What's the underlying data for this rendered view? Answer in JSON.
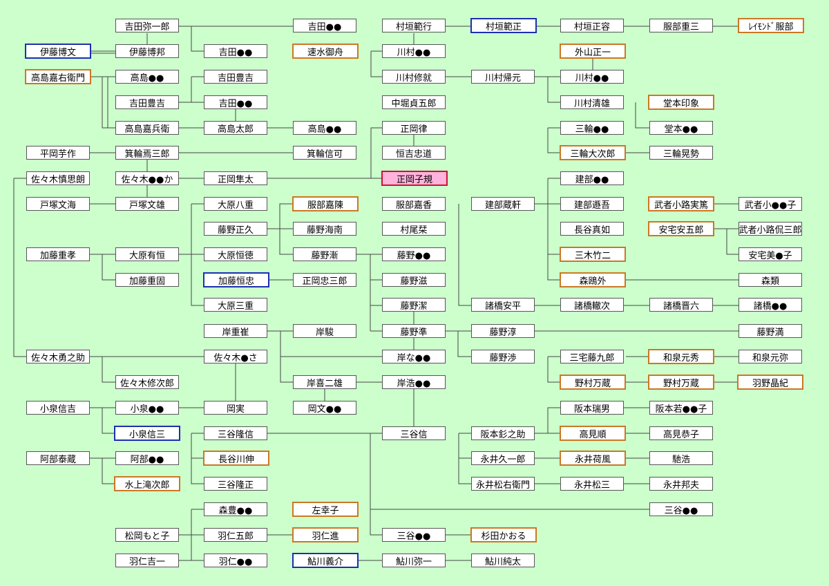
{
  "colors": {
    "background": "#ccffcc",
    "line": "#444444",
    "blue": "#1a2fb0",
    "orange": "#cc7722",
    "red": "#cc1133",
    "pink": "#ffb3dd"
  },
  "people": {
    "yoshida_yaichiro": "吉田弥一郎",
    "yoshida_a": "吉田●●",
    "murakaki_norimichi": "村垣範行",
    "murakaki_norimasa": "村垣範正",
    "murakaki_masakata": "村垣正容",
    "hattori_juzo": "服部重三",
    "raymond_hattori": "ﾚｲﾓﾝﾄﾞ服部",
    "ito_hirobumi": "伊藤博文",
    "ito_hirokuni": "伊藤博邦",
    "yoshida_b": "吉田●●",
    "hayami_gyoshu": "速水御舟",
    "kawamura_a": "川村●●",
    "toyama_masakazu": "外山正一",
    "takashima_kaemon": "高島嘉右衛門",
    "takashima_a": "高島●●",
    "yoshida_toyokichi2": "吉田豊吉",
    "kawamura_shuju": "川村修就",
    "kawamura_kigen": "川村帰元",
    "kawamura_b": "川村●●",
    "yoshida_toyokichi": "吉田豊吉",
    "yoshida_c": "吉田●●",
    "nakabori": "中堀貞五郎",
    "kawamura_kiyoo": "川村清雄",
    "domoto_insho": "堂本印象",
    "takashima_kahei": "高島嘉兵衛",
    "takashima_taro": "高島太郎",
    "takashima_b": "高島●●",
    "masaoka_ritsu": "正岡律",
    "miwa_a": "三輪●●",
    "domoto_a": "堂本●●",
    "hiraoka_imosaku": "平岡芋作",
    "minowa_eizaburo": "箕輪焉三郎",
    "minowa_nobuyoshi": "箕輪信可",
    "tsuneyoshi": "恒吉忠道",
    "miwa_daijiro": "三輪大次郎",
    "miwa_koshi": "三輪晃勢",
    "sasaki_shinshiro": "佐々木慎思朗",
    "sasaki_a": "佐々木●●か",
    "masaoka_hayata": "正岡隼太",
    "masaoka_shiki": "正岡子規",
    "takebe_a": "建部●●",
    "totsuka_bunkai": "戸塚文海",
    "totsuka_fumio": "戸塚文雄",
    "ohara_hachie": "大原八重",
    "hattori_kaetsu": "服部嘉陳",
    "hattori_kaka": "服部嘉香",
    "takebe_kuraki": "建部蔵軒",
    "takebe_tongo": "建部遯吾",
    "mushanokoji_saneatsu": "武者小路実篤",
    "mushanokoji_a": "武者小●●子",
    "fujino_masahisa": "藤野正久",
    "fujino_kainan": "藤野海南",
    "murao_ui": "村尾栞",
    "hasegawa_nyoze": "長谷真如",
    "yasugi_yasugoro": "安宅安五郎",
    "mushanokoji_b": "武者小路侃三郎",
    "kato_shigetaka": "加藤重孝",
    "ohara_arinori": "大原有恒",
    "ohara_tsunenori": "大原恒徳",
    "fujino_zen": "藤野漸",
    "fujino_a": "藤野●●",
    "miki_takeji": "三木竹二",
    "yasugi_b": "安宅美●子",
    "kato_shigekata": "加藤重固",
    "kato_tsunetada": "加藤恒忠",
    "masaoka_chuzaburo": "正岡忠三郎",
    "fujino_shigeru": "藤野滋",
    "mori_ogai": "森鴎外",
    "mori_rui": "森類",
    "ohara_mie": "大原三重",
    "fujino_kiyoshi": "藤野潔",
    "morohashi_yasuhira": "諸橋安平",
    "morohashi_tetsuji": "諸橋轍次",
    "morohashi_shinroku": "諸橋晋六",
    "morohashi_a": "諸橋●●",
    "kishi_shigetaka": "岸重崔",
    "kishi_shun": "岸駿",
    "fujino_jun": "藤野準",
    "fujino_atsushi": "藤野淳",
    "fujino_mitsuru": "藤野満",
    "sasaki_yunosuke": "佐々木勇之助",
    "sasaki_b": "佐々木●さ",
    "kishi_a": "岸な●●",
    "fujino_wataru": "藤野渉",
    "miyake_tokyuro": "三宅藤九郎",
    "izumi_motohide": "和泉元秀",
    "izumi_motoya": "和泉元弥",
    "sasaki_shujiro": "佐々木修次郎",
    "kishi_kijio": "岸喜二雄",
    "kishi_b": "岸浩●●",
    "nomura_manzo1": "野村万蔵",
    "nomura_manzo2": "野村万蔵",
    "hano_akinori": "羽野晶紀",
    "koizumi_nobukichi": "小泉信吉",
    "koizumi_a": "小泉●●",
    "oka_minoru": "岡実",
    "oka_b": "岡文●●",
    "sakamoto_mizuo": "阪本瑞男",
    "sakamoto_a": "阪本若●●子",
    "koizumi_shinzo": "小泉信三",
    "mitani_takanobu": "三谷隆信",
    "mitani_shin": "三谷信",
    "sakamoto_kinnosuke": "阪本釤之助",
    "takami_jun": "高見順",
    "takami_kyoko": "高見恭子",
    "abe_taizo": "阿部泰蔵",
    "abe_a": "阿部●●",
    "hasegawa_shin": "長谷川伸",
    "nagai_kyuichiro": "永井久一郎",
    "nagai_kafu": "永井荷風",
    "hayao": "馳浩",
    "minakami_takitaro": "水上滝次郎",
    "mitani_takamasa": "三谷隆正",
    "nagai_matsuemon": "永井松右衛門",
    "nagai_matsuzo": "永井松三",
    "nagai_kunio": "永井邦夫",
    "mori_a": "森豊●●",
    "hidari_sachiko": "左幸子",
    "mitani_b": "三谷●●",
    "matsuoka_motoko": "松岡もと子",
    "hani_goro": "羽仁五郎",
    "hani_susumu": "羽仁進",
    "mitani_c": "三谷●●",
    "sugita_kaoru": "杉田かおる",
    "hani_kichiichi": "羽仁吉一",
    "hani_a": "羽仁●●",
    "ayukawa_yoshisuke": "鮎川義介",
    "ayukawa_yaichi": "鮎川弥一",
    "ayukawa_junta": "鮎川純太"
  }
}
